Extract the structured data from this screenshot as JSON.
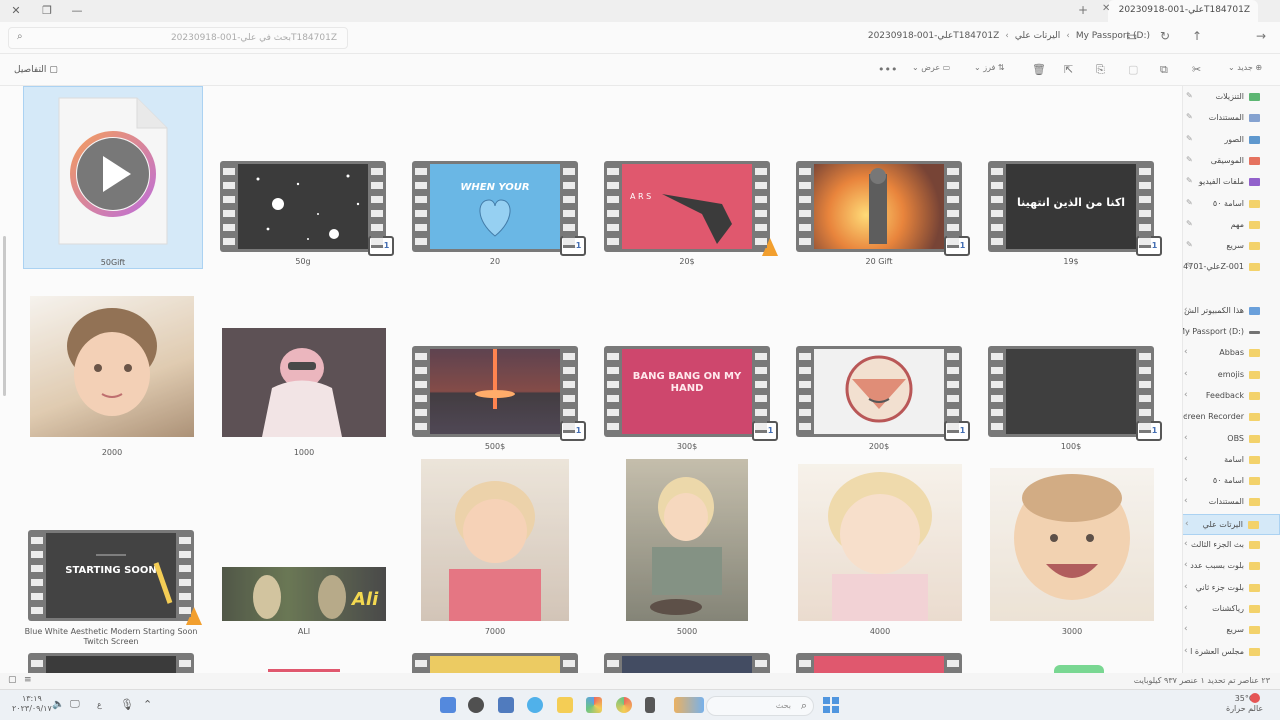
{
  "window": {
    "tab_title": "علي-001-20230918T184701Z",
    "minimize": "—",
    "maximize": "❐",
    "close": "✕",
    "new_tab": "+"
  },
  "address": {
    "search_placeholder": "بحث في علي-001-20230918T184701Z",
    "crumbs": [
      "My Passport (D:)",
      "اليرتات علي",
      "علي-001-20230918T184701Z"
    ]
  },
  "toolbar": {
    "new_label": "جديد",
    "sort_label": "فرز",
    "view_label": "عرض",
    "more": "•••",
    "details_label": "التفاصيل"
  },
  "items": [
    {
      "name": "50Gift",
      "kind": "file-play"
    },
    {
      "name": "50g",
      "kind": "video",
      "bg": "#111",
      "badge": "321"
    },
    {
      "name": "20",
      "kind": "video",
      "bg": "#4aa8e0",
      "badge": "321",
      "caption": "WHEN YOUR"
    },
    {
      "name": "20$",
      "kind": "video",
      "bg": "#d9344f",
      "badge": "cone"
    },
    {
      "name": "20 Gift",
      "kind": "video",
      "bg": "#c85a1a",
      "badge": "321"
    },
    {
      "name": "19$",
      "kind": "video",
      "bg": "#0b0b0b",
      "badge": "321",
      "caption": "اكنا من الذين انتهينا"
    },
    {
      "name": "2000",
      "kind": "photo",
      "bg": "#c9a47a"
    },
    {
      "name": "1000",
      "kind": "photo",
      "bg": "#3a2b30"
    },
    {
      "name": "500$",
      "kind": "video",
      "bg": "#3a2020",
      "badge": "321"
    },
    {
      "name": "300$",
      "kind": "video",
      "bg": "#c41f4d",
      "badge": "321",
      "caption": "BANG BANG ON MY HAND"
    },
    {
      "name": "200$",
      "kind": "video",
      "bg": "#e8e8e8",
      "badge": "321"
    },
    {
      "name": "100$",
      "kind": "video",
      "bg": "#151515",
      "badge": "321"
    },
    {
      "name": "Blue White Aesthetic Modern Starting Soon Twitch Screen",
      "kind": "video",
      "bg": "#1a1a1a",
      "badge": "cone",
      "caption": "STARTING SOON"
    },
    {
      "name": "ALI",
      "kind": "photo",
      "bg": "#3d4a2a"
    },
    {
      "name": "7000",
      "kind": "photo",
      "bg": "#d9a58a"
    },
    {
      "name": "5000",
      "kind": "photo",
      "bg": "#8a8570"
    },
    {
      "name": "4000",
      "kind": "photo",
      "bg": "#e5c6b8"
    },
    {
      "name": "3000",
      "kind": "photo",
      "bg": "#d9b090"
    }
  ],
  "nav": [
    {
      "label": "التنزيلات",
      "type": "pinned",
      "color": "#3aa655"
    },
    {
      "label": "المستندات",
      "type": "pinned",
      "color": "#6b8ec6"
    },
    {
      "label": "الصور",
      "type": "pinned",
      "color": "#3c82c4"
    },
    {
      "label": "الموسيقى",
      "type": "pinned",
      "color": "#e0543c"
    },
    {
      "label": "ملفات الفيديو",
      "type": "pinned",
      "color": "#7a3fc0"
    },
    {
      "label": "اسامة ٥٠",
      "type": "pinned",
      "color": "#f1c84b"
    },
    {
      "label": "مهم",
      "type": "pinned",
      "color": "#f1c84b"
    },
    {
      "label": "سريع",
      "type": "pinned",
      "color": "#f1c84b"
    },
    {
      "label": "علي-84701Z-001",
      "type": "pinned",
      "color": "#f1c84b"
    },
    {
      "label": "هذا الكمبيوتر الش",
      "type": "root",
      "color": "#4a8bd4"
    },
    {
      "label": "My Passport (D:)",
      "type": "drive",
      "color": "#555"
    },
    {
      "label": "Abbas",
      "type": "folder"
    },
    {
      "label": "emojis",
      "type": "folder"
    },
    {
      "label": "Feedback",
      "type": "folder"
    },
    {
      "label": "creen Recorder",
      "type": "folder"
    },
    {
      "label": "OBS",
      "type": "folder"
    },
    {
      "label": "اسامة",
      "type": "folder"
    },
    {
      "label": "اسامة ٥٠",
      "type": "folder"
    },
    {
      "label": "المستندات",
      "type": "folder"
    },
    {
      "label": "اليرتات علي",
      "type": "folder",
      "selected": true
    },
    {
      "label": "بث الجزء الثالث",
      "type": "folder"
    },
    {
      "label": "بلوت بسبب عدد",
      "type": "folder"
    },
    {
      "label": "بلوت جزء ثاني",
      "type": "folder"
    },
    {
      "label": "رياكشنات",
      "type": "folder"
    },
    {
      "label": "سريع",
      "type": "folder"
    },
    {
      "label": "مجلس العشرة ا",
      "type": "folder"
    }
  ],
  "status": {
    "text": "٢٣ عناصر   تم تحديد ١ عنصر  ٩٣٧ كيلوبايت"
  },
  "taskbar": {
    "search_placeholder": "بحث",
    "weather_temp": "35°C",
    "weather_desc": "عالم حرارة",
    "time": "١٣:١٩",
    "date": "٢٠٢٣/٠٩/١٧",
    "lang": "ع"
  }
}
